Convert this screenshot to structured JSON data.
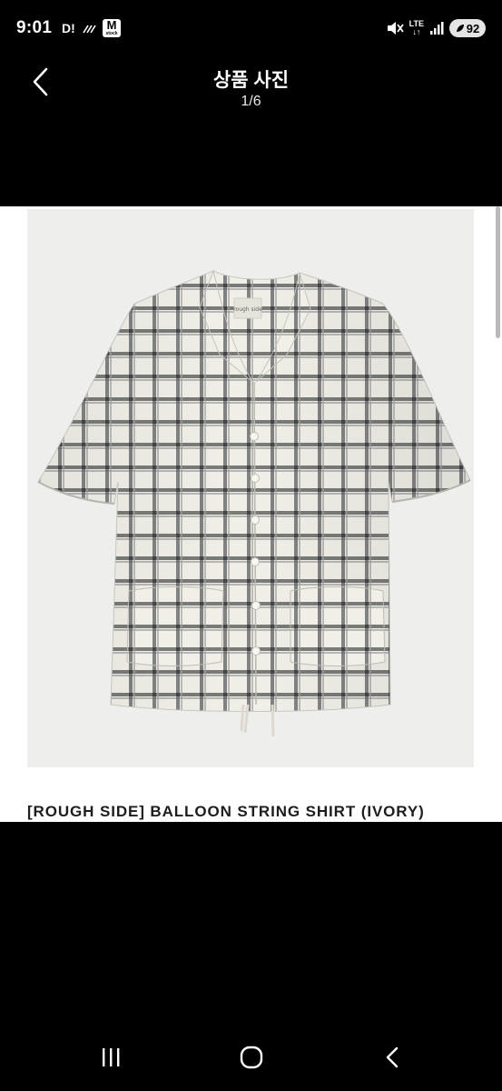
{
  "status_bar": {
    "time": "9:01",
    "notif_d": "D!",
    "m_app_letter": "M",
    "m_app_sub": "stock",
    "lte": "LTE",
    "battery": "92"
  },
  "header": {
    "title": "상품 사진",
    "page_indicator": "1/6"
  },
  "product": {
    "name": "[ROUGH SIDE] BALLOON STRING SHIRT (IVORY)",
    "label_text": "rough side"
  },
  "colors": {
    "background": "#000000",
    "photo_background": "#eeeeec",
    "shirt_base": "#f1efe8",
    "check_dark": "#55585a",
    "check_light": "#9a9d9b"
  }
}
